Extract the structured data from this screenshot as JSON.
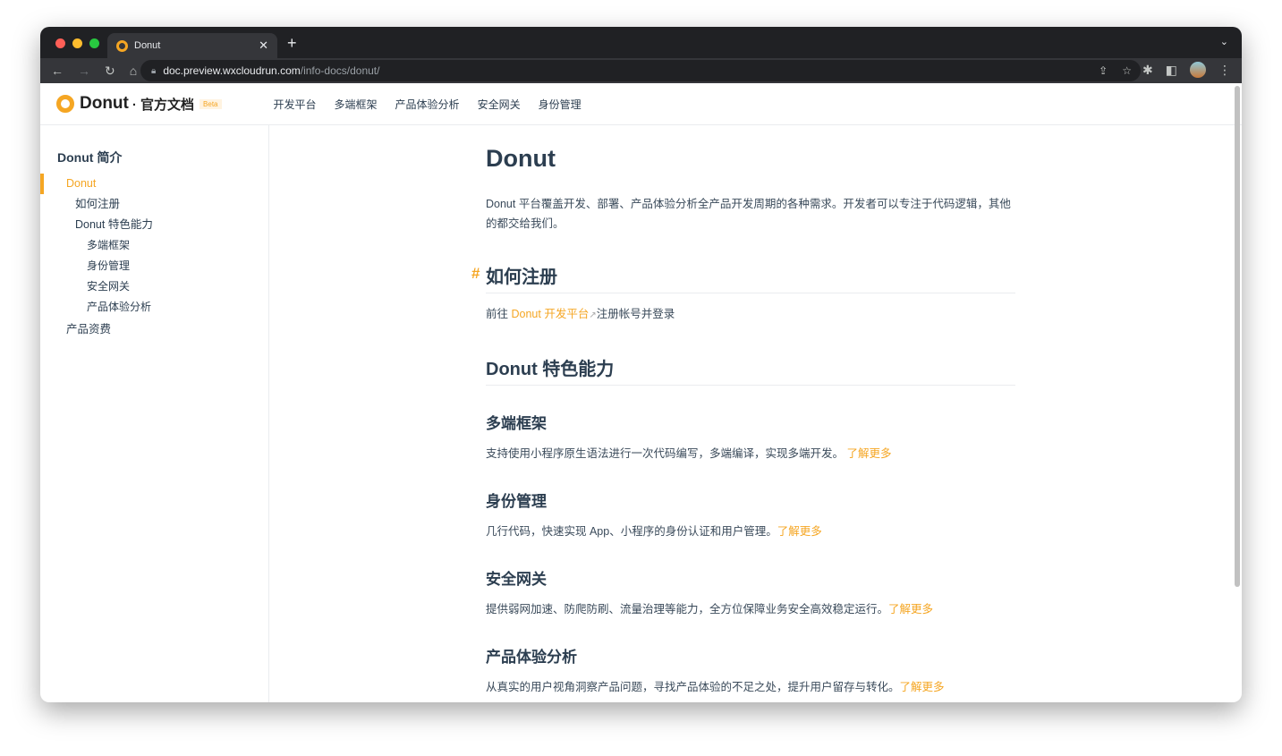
{
  "browser": {
    "tab_title": "Donut",
    "url_host": "doc.preview.wxcloudrun.com",
    "url_path": "/info-docs/donut/"
  },
  "header": {
    "brand": "Donut",
    "brand_sub": "· 官方文档",
    "beta": "Beta",
    "nav": [
      "开发平台",
      "多端框架",
      "产品体验分析",
      "安全网关",
      "身份管理"
    ]
  },
  "sidebar": {
    "heading": "Donut 简介",
    "items": [
      "Donut",
      "如何注册",
      "Donut 特色能力",
      "多端框架",
      "身份管理",
      "安全网关",
      "产品体验分析",
      "产品资费"
    ]
  },
  "main": {
    "title": "Donut",
    "intro": "Donut 平台覆盖开发、部署、产品体验分析全产品开发周期的各种需求。开发者可以专注于代码逻辑，其他的都交给我们。",
    "register_heading": "如何注册",
    "register_pre": "前往 ",
    "register_link": "Donut 开发平台",
    "register_post": "注册帐号并登录",
    "features_heading": "Donut 特色能力",
    "features": [
      {
        "title": "多端框架",
        "desc": "支持使用小程序原生语法进行一次代码编写，多端编译，实现多端开发。 ",
        "link": "了解更多"
      },
      {
        "title": "身份管理",
        "desc": "几行代码，快速实现 App、小程序的身份认证和用户管理。",
        "link": "了解更多"
      },
      {
        "title": "安全网关",
        "desc": "提供弱网加速、防爬防刷、流量治理等能力，全方位保障业务安全高效稳定运行。",
        "link": "了解更多"
      },
      {
        "title": "产品体验分析",
        "desc": "从真实的用户视角洞察产品问题，寻找产品体验的不足之处，提升用户留存与转化。",
        "link": "了解更多"
      }
    ]
  }
}
